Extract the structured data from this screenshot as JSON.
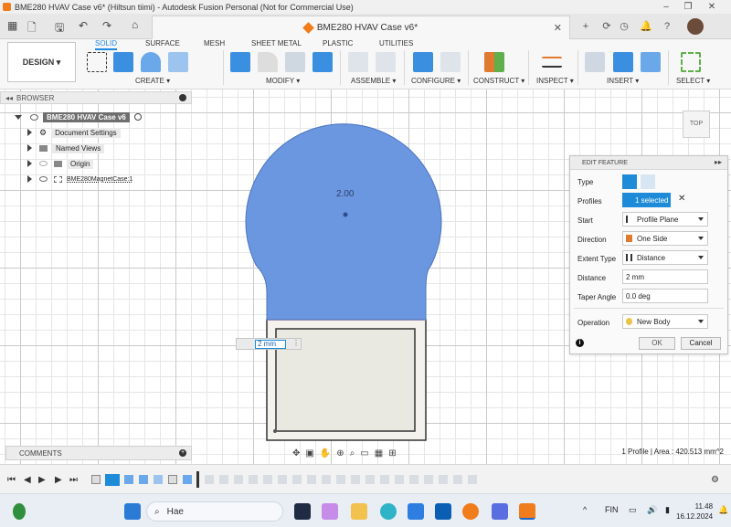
{
  "window": {
    "title": "BME280 HVAV Case v6* (Hiltsun tiimi) - Autodesk Fusion Personal (Not for Commercial Use)"
  },
  "tabs": {
    "active_doc": "BME280 HVAV Case v6*"
  },
  "toolbar": {
    "design_label": "DESIGN",
    "workspace_tabs": [
      "SOLID",
      "SURFACE",
      "MESH",
      "SHEET METAL",
      "PLASTIC",
      "UTILITIES"
    ],
    "groups": [
      "CREATE",
      "MODIFY",
      "ASSEMBLE",
      "CONFIGURE",
      "CONSTRUCT",
      "INSPECT",
      "INSERT",
      "SELECT"
    ]
  },
  "browser": {
    "title": "BROWSER",
    "root": "BME280 HVAV Case v6",
    "items": [
      "Document Settings",
      "Named Views",
      "Origin",
      "BME280MagnetCase:1"
    ]
  },
  "comments": {
    "title": "COMMENTS"
  },
  "canvas": {
    "sketch_dim": "2.00",
    "extrude_input": "2 mm",
    "viewcube": "TOP"
  },
  "edit_feature": {
    "title": "EDIT FEATURE",
    "rows": {
      "type": "Type",
      "profiles": "Profiles",
      "profiles_value": "1 selected",
      "start": "Start",
      "start_value": "Profile Plane",
      "direction": "Direction",
      "direction_value": "One Side",
      "extent_type": "Extent Type",
      "extent_type_value": "Distance",
      "distance": "Distance",
      "distance_value": "2 mm",
      "taper": "Taper Angle",
      "taper_value": "0.0 deg",
      "operation": "Operation",
      "operation_value": "New Body"
    },
    "ok": "OK",
    "cancel": "Cancel"
  },
  "status": {
    "text": "1 Profile | Area : 420.513 mm^2"
  },
  "taskbar": {
    "search_text": "Hae",
    "lang": "FIN",
    "time": "11.48",
    "date": "16.12.2024"
  },
  "colors": {
    "accent": "#1e88e5",
    "profile_fill": "#6a97e0",
    "sketch_fill": "#f4f2ec"
  }
}
